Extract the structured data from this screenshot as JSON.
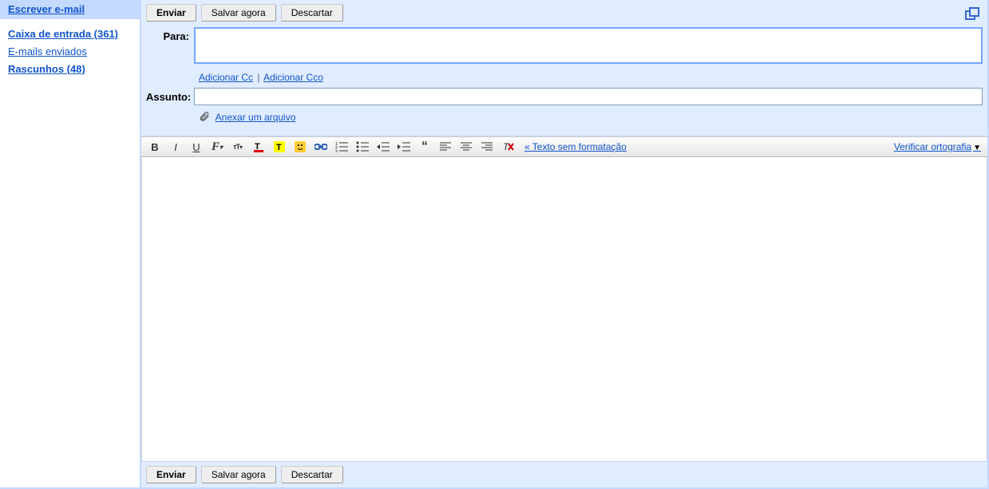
{
  "sidebar": {
    "compose": "Escrever e-mail",
    "items": [
      {
        "label": "Caixa de entrada (361)",
        "bold": true
      },
      {
        "label": "E-mails enviados",
        "bold": false
      },
      {
        "label": "Rascunhos (48)",
        "bold": true
      }
    ]
  },
  "buttons": {
    "send": "Enviar",
    "save": "Salvar agora",
    "discard": "Descartar"
  },
  "fields": {
    "to_label": "Para:",
    "to_value": "",
    "add_cc": "Adicionar Cc",
    "add_bcc": "Adicionar Cco",
    "subject_label": "Assunto:",
    "subject_value": "",
    "attach": "Anexar um arquivo"
  },
  "toolbar": {
    "plain_text": "« Texto sem formatação",
    "spellcheck": "Verificar ortografia"
  }
}
